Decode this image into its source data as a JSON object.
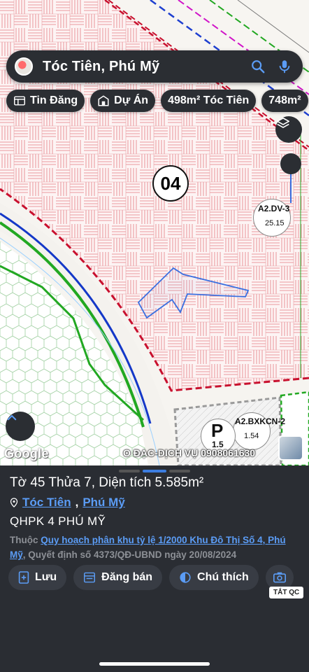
{
  "search": {
    "query": "Tóc Tiên, Phú Mỹ",
    "icons": [
      "search-icon",
      "mic-icon"
    ]
  },
  "chips": [
    {
      "label": "Tin Đăng",
      "icon": "listing-icon"
    },
    {
      "label": "Dự Án",
      "icon": "building-icon"
    },
    {
      "label": "498m² Tóc Tiên",
      "icon": ""
    },
    {
      "label": "748m²",
      "icon": ""
    }
  ],
  "map": {
    "zone_number": "04",
    "zone_a2dv": {
      "code": "A2.DV-3",
      "value": "25.15"
    },
    "zone_a2bx": {
      "code": "A2.BXKCN-2",
      "value": "1.54"
    },
    "parking_symbol": "P",
    "parking_value": "1.5",
    "attribution": "Google",
    "watermark": "O ĐẠC-DỊCH VỤ 0908061630",
    "colors": {
      "zone_border": "#c8102e",
      "parcel": "#3a6fe0",
      "road_green": "#22a822",
      "road_blue": "#1438c8"
    }
  },
  "sheet": {
    "title": "Tờ 45 Thửa 7, Diện tích 5.585m²",
    "location_a": "Tóc Tiên",
    "location_sep": ",",
    "location_b": "Phú Mỹ",
    "plan_name": "QHPK 4 PHÚ MỸ",
    "desc_prefix": "Thuộc",
    "desc_link": "Quy hoạch phân khu tỷ lệ 1/2000 Khu Đô Thị Số 4, Phú Mỹ",
    "desc_suffix": ", Quyết định số 4373/QĐ-UBND ngày 20/08/2024",
    "actions": [
      {
        "label": "Lưu",
        "icon": "save-icon"
      },
      {
        "label": "Đăng bán",
        "icon": "sell-icon"
      },
      {
        "label": "Chú thích",
        "icon": "legend-icon"
      }
    ],
    "hide_label": "TẮT QC"
  }
}
